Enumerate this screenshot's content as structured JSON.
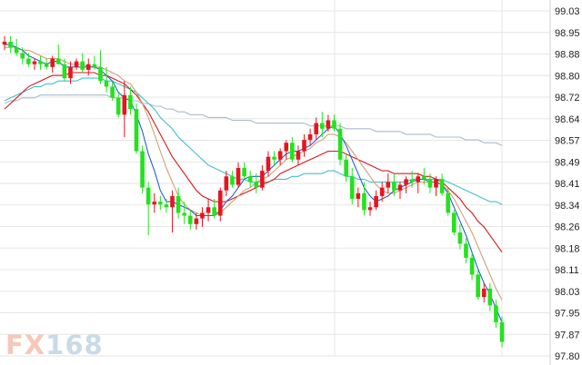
{
  "chart_data": {
    "type": "candlestick",
    "title": "",
    "xlabel": "",
    "ylabel": "",
    "ylim": [
      97.8,
      99.03
    ],
    "y_ticks": [
      "99.03",
      "98.95",
      "98.88",
      "98.80",
      "98.72",
      "98.64",
      "98.57",
      "98.49",
      "98.41",
      "98.34",
      "98.26",
      "98.18",
      "98.11",
      "98.03",
      "97.95",
      "97.87",
      "97.80"
    ],
    "grid": true,
    "axis_side": "right",
    "colors": {
      "up": "#e8141e",
      "down": "#22e31c",
      "ma_short": "#2060d8",
      "ma_mid": "#d0a078",
      "ma_long_red": "#d81818",
      "ma_cyan": "#40c0d0",
      "ma_grey": "#a8bcd0"
    },
    "candles": [
      [
        98.91,
        98.94,
        98.89,
        98.92
      ],
      [
        98.92,
        98.94,
        98.88,
        98.9
      ],
      [
        98.9,
        98.93,
        98.87,
        98.88
      ],
      [
        98.88,
        98.9,
        98.84,
        98.86
      ],
      [
        98.86,
        98.88,
        98.83,
        98.84
      ],
      [
        98.84,
        98.86,
        98.82,
        98.85
      ],
      [
        98.85,
        98.87,
        98.82,
        98.84
      ],
      [
        98.84,
        98.86,
        98.82,
        98.83
      ],
      [
        98.83,
        98.87,
        98.81,
        98.86
      ],
      [
        98.86,
        98.91,
        98.84,
        98.84
      ],
      [
        98.84,
        98.86,
        98.78,
        98.79
      ],
      [
        98.79,
        98.85,
        98.77,
        98.83
      ],
      [
        98.83,
        98.86,
        98.82,
        98.85
      ],
      [
        98.85,
        98.88,
        98.81,
        98.82
      ],
      [
        98.82,
        98.86,
        98.8,
        98.84
      ],
      [
        98.84,
        98.87,
        98.82,
        98.83
      ],
      [
        98.83,
        98.89,
        98.77,
        98.78
      ],
      [
        98.78,
        98.83,
        98.74,
        98.76
      ],
      [
        98.76,
        98.78,
        98.71,
        98.72
      ],
      [
        98.72,
        98.74,
        98.65,
        98.66
      ],
      [
        98.66,
        98.78,
        98.58,
        98.73
      ],
      [
        98.73,
        98.76,
        98.66,
        98.68
      ],
      [
        98.68,
        98.7,
        98.52,
        98.53
      ],
      [
        98.53,
        98.55,
        98.38,
        98.4
      ],
      [
        98.4,
        98.42,
        98.23,
        98.34
      ],
      [
        98.34,
        98.38,
        98.31,
        98.35
      ],
      [
        98.35,
        98.37,
        98.32,
        98.34
      ],
      [
        98.34,
        98.36,
        98.31,
        98.33
      ],
      [
        98.33,
        98.39,
        98.24,
        98.37
      ],
      [
        98.37,
        98.4,
        98.29,
        98.31
      ],
      [
        98.31,
        98.35,
        98.27,
        98.3
      ],
      [
        98.3,
        98.32,
        98.25,
        98.27
      ],
      [
        98.27,
        98.31,
        98.25,
        98.29
      ],
      [
        98.29,
        98.33,
        98.26,
        98.31
      ],
      [
        98.31,
        98.36,
        98.28,
        98.33
      ],
      [
        98.33,
        98.36,
        98.29,
        98.3
      ],
      [
        98.3,
        98.4,
        98.28,
        98.39
      ],
      [
        98.39,
        98.46,
        98.37,
        98.44
      ],
      [
        98.44,
        98.46,
        98.4,
        98.41
      ],
      [
        98.41,
        98.49,
        98.4,
        98.47
      ],
      [
        98.47,
        98.49,
        98.43,
        98.44
      ],
      [
        98.44,
        98.46,
        98.4,
        98.42
      ],
      [
        98.42,
        98.45,
        98.38,
        98.4
      ],
      [
        98.4,
        98.48,
        98.39,
        98.46
      ],
      [
        98.46,
        98.53,
        98.44,
        98.51
      ],
      [
        98.51,
        98.53,
        98.48,
        98.5
      ],
      [
        98.5,
        98.54,
        98.48,
        98.53
      ],
      [
        98.53,
        98.57,
        98.5,
        98.56
      ],
      [
        98.56,
        98.58,
        98.49,
        98.5
      ],
      [
        98.5,
        98.55,
        98.48,
        98.53
      ],
      [
        98.53,
        98.59,
        98.51,
        98.57
      ],
      [
        98.57,
        98.61,
        98.55,
        98.59
      ],
      [
        98.59,
        98.65,
        98.57,
        98.63
      ],
      [
        98.63,
        98.67,
        98.58,
        98.61
      ],
      [
        98.61,
        98.66,
        98.6,
        98.64
      ],
      [
        98.64,
        98.66,
        98.6,
        98.61
      ],
      [
        98.61,
        98.63,
        98.48,
        98.5
      ],
      [
        98.5,
        98.52,
        98.42,
        98.44
      ],
      [
        98.44,
        98.47,
        98.34,
        98.36
      ],
      [
        98.36,
        98.4,
        98.33,
        98.38
      ],
      [
        98.38,
        98.42,
        98.3,
        98.32
      ],
      [
        98.32,
        98.35,
        98.3,
        98.33
      ],
      [
        98.33,
        98.39,
        98.32,
        98.37
      ],
      [
        98.37,
        98.42,
        98.35,
        98.4
      ],
      [
        98.4,
        98.45,
        98.38,
        98.42
      ],
      [
        98.42,
        98.45,
        98.37,
        98.39
      ],
      [
        98.39,
        98.42,
        98.36,
        98.41
      ],
      [
        98.41,
        98.44,
        98.38,
        98.43
      ],
      [
        98.43,
        98.46,
        98.4,
        98.42
      ],
      [
        98.42,
        98.45,
        98.38,
        98.44
      ],
      [
        98.44,
        98.47,
        98.41,
        98.43
      ],
      [
        98.43,
        98.45,
        98.38,
        98.4
      ],
      [
        98.4,
        98.44,
        98.37,
        98.43
      ],
      [
        98.43,
        98.45,
        98.37,
        98.38
      ],
      [
        98.38,
        98.4,
        98.3,
        98.31
      ],
      [
        98.31,
        98.32,
        98.23,
        98.24
      ],
      [
        98.24,
        98.27,
        98.18,
        98.2
      ],
      [
        98.2,
        98.22,
        98.13,
        98.15
      ],
      [
        98.15,
        98.17,
        98.07,
        98.09
      ],
      [
        98.09,
        98.11,
        98.0,
        98.01
      ],
      [
        98.01,
        98.06,
        97.99,
        98.04
      ],
      [
        98.04,
        98.06,
        97.96,
        97.98
      ],
      [
        97.98,
        98.0,
        97.9,
        97.92
      ],
      [
        97.92,
        97.94,
        97.83,
        97.85
      ]
    ],
    "moving_averages": {
      "ma_short": [
        98.91,
        98.91,
        98.9,
        98.89,
        98.87,
        98.86,
        98.85,
        98.84,
        98.85,
        98.85,
        98.83,
        98.83,
        98.83,
        98.83,
        98.83,
        98.83,
        98.82,
        98.8,
        98.78,
        98.74,
        98.72,
        98.71,
        98.66,
        98.6,
        98.52,
        98.46,
        98.39,
        98.35,
        98.35,
        98.34,
        98.33,
        98.32,
        98.3,
        98.3,
        98.3,
        98.3,
        98.32,
        98.35,
        98.37,
        98.4,
        98.43,
        98.44,
        98.44,
        98.44,
        98.46,
        98.48,
        98.5,
        98.52,
        98.53,
        98.53,
        98.54,
        98.55,
        98.57,
        98.59,
        98.61,
        98.62,
        98.59,
        98.55,
        98.5,
        98.45,
        98.4,
        98.37,
        98.35,
        98.36,
        98.37,
        98.39,
        98.4,
        98.41,
        98.42,
        98.43,
        98.43,
        98.42,
        98.42,
        98.41,
        98.38,
        98.33,
        98.28,
        98.23,
        98.17,
        98.11,
        98.06,
        98.02,
        97.97,
        97.92
      ],
      "ma_mid": [
        98.9,
        98.9,
        98.9,
        98.89,
        98.89,
        98.88,
        98.87,
        98.86,
        98.86,
        98.86,
        98.85,
        98.84,
        98.84,
        98.84,
        98.83,
        98.83,
        98.83,
        98.82,
        98.81,
        98.8,
        98.78,
        98.77,
        98.74,
        98.7,
        98.65,
        98.59,
        98.53,
        98.47,
        98.42,
        98.37,
        98.34,
        98.32,
        98.31,
        98.3,
        98.3,
        98.3,
        98.31,
        98.33,
        98.35,
        98.37,
        98.39,
        98.4,
        98.42,
        98.43,
        98.44,
        98.46,
        98.48,
        98.5,
        98.51,
        98.52,
        98.53,
        98.54,
        98.56,
        98.57,
        98.59,
        98.59,
        98.58,
        98.56,
        98.53,
        98.5,
        98.47,
        98.44,
        98.41,
        98.39,
        98.38,
        98.38,
        98.39,
        98.4,
        98.41,
        98.42,
        98.42,
        98.42,
        98.42,
        98.41,
        98.39,
        98.36,
        98.32,
        98.28,
        98.24,
        98.19,
        98.14,
        98.09,
        98.04,
        98.0
      ],
      "ma_long_red": [
        98.68,
        98.7,
        98.72,
        98.74,
        98.76,
        98.77,
        98.78,
        98.79,
        98.8,
        98.8,
        98.8,
        98.81,
        98.81,
        98.81,
        98.81,
        98.81,
        98.8,
        98.8,
        98.79,
        98.78,
        98.77,
        98.75,
        98.73,
        98.7,
        98.67,
        98.63,
        98.59,
        98.55,
        98.51,
        98.48,
        98.45,
        98.42,
        98.39,
        98.37,
        98.36,
        98.35,
        98.35,
        98.35,
        98.36,
        98.37,
        98.38,
        98.39,
        98.4,
        98.41,
        98.42,
        98.43,
        98.45,
        98.46,
        98.47,
        98.48,
        98.49,
        98.5,
        98.51,
        98.52,
        98.53,
        98.53,
        98.53,
        98.52,
        98.51,
        98.5,
        98.49,
        98.48,
        98.47,
        98.46,
        98.46,
        98.45,
        98.45,
        98.45,
        98.45,
        98.45,
        98.44,
        98.44,
        98.43,
        98.42,
        98.4,
        98.38,
        98.36,
        98.33,
        98.31,
        98.28,
        98.26,
        98.23,
        98.2,
        98.17
      ],
      "ma_cyan": [
        98.71,
        98.72,
        98.73,
        98.74,
        98.75,
        98.76,
        98.76,
        98.77,
        98.77,
        98.78,
        98.78,
        98.78,
        98.78,
        98.79,
        98.79,
        98.79,
        98.79,
        98.78,
        98.78,
        98.77,
        98.76,
        98.75,
        98.74,
        98.72,
        98.7,
        98.68,
        98.65,
        98.63,
        98.61,
        98.58,
        98.56,
        98.54,
        98.52,
        98.5,
        98.48,
        98.47,
        98.46,
        98.45,
        98.44,
        98.43,
        98.43,
        98.42,
        98.42,
        98.42,
        98.42,
        98.43,
        98.43,
        98.43,
        98.44,
        98.44,
        98.45,
        98.45,
        98.45,
        98.45,
        98.46,
        98.46,
        98.45,
        98.44,
        98.44,
        98.43,
        98.43,
        98.42,
        98.42,
        98.42,
        98.42,
        98.42,
        98.42,
        98.42,
        98.43,
        98.43,
        98.43,
        98.43,
        98.43,
        98.43,
        98.42,
        98.41,
        98.4,
        98.39,
        98.38,
        98.37,
        98.36,
        98.35,
        98.35,
        98.34
      ],
      "ma_grey": [
        98.7,
        98.71,
        98.71,
        98.72,
        98.72,
        98.72,
        98.73,
        98.73,
        98.73,
        98.73,
        98.73,
        98.73,
        98.73,
        98.73,
        98.73,
        98.73,
        98.73,
        98.73,
        98.72,
        98.72,
        98.72,
        98.71,
        98.71,
        98.7,
        98.7,
        98.69,
        98.69,
        98.68,
        98.68,
        98.67,
        98.67,
        98.66,
        98.66,
        98.66,
        98.65,
        98.65,
        98.65,
        98.65,
        98.64,
        98.64,
        98.64,
        98.64,
        98.63,
        98.63,
        98.63,
        98.63,
        98.63,
        98.63,
        98.63,
        98.63,
        98.63,
        98.62,
        98.62,
        98.62,
        98.62,
        98.62,
        98.62,
        98.61,
        98.61,
        98.61,
        98.61,
        98.61,
        98.6,
        98.6,
        98.6,
        98.6,
        98.6,
        98.59,
        98.59,
        98.59,
        98.59,
        98.59,
        98.58,
        98.58,
        98.58,
        98.58,
        98.58,
        98.57,
        98.57,
        98.57,
        98.56,
        98.56,
        98.56,
        98.55
      ]
    }
  },
  "watermark": {
    "text": "FX168"
  }
}
